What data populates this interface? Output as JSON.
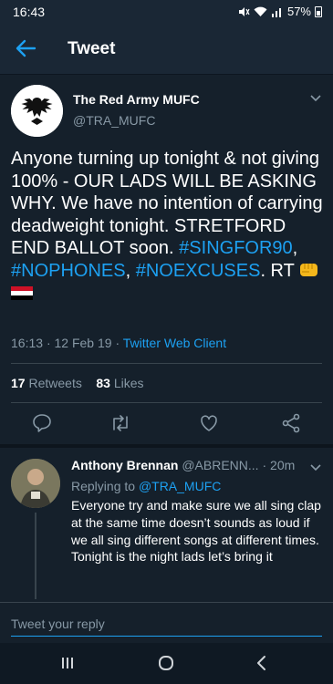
{
  "status": {
    "time": "16:43",
    "battery": "57%"
  },
  "header": {
    "title": "Tweet"
  },
  "tweet": {
    "author_name": "The Red Army MUFC",
    "author_handle": "@TRA_MUFC",
    "text_segments": [
      "Anyone turning up tonight & not giving 100% - OUR LADS WILL BE ASKING WHY. We have no intention of carrying deadweight tonight. STRETFORD END BALLOT soon. ",
      "#SINGFOR90",
      ", ",
      "#NOPHONES",
      ", ",
      "#NOEXCUSES",
      ". RT "
    ],
    "time": "16:13",
    "date": "12 Feb 19",
    "separator": "·",
    "client": "Twitter Web Client",
    "retweets_count": "17",
    "retweets_label": "Retweets",
    "likes_count": "83",
    "likes_label": "Likes"
  },
  "reply": {
    "name": "Anthony Brennan",
    "handle": "@ABRENN...",
    "age": "20m",
    "replying_prefix": "Replying to",
    "replying_handle": "@TRA_MUFC",
    "text": "Everyone try and make sure we all sing clap at the same time doesn’t sounds as loud if we all sing different songs at different times. Tonight is the night lads let’s bring it"
  },
  "compose": {
    "placeholder": "Tweet your reply"
  },
  "colors": {
    "background": "#15202b",
    "accent": "#1da1f2",
    "muted": "#8899a6",
    "divider": "#38444d"
  },
  "icons": [
    "back-arrow-icon",
    "chevron-down-icon",
    "reply-icon",
    "retweet-icon",
    "like-icon",
    "share-icon",
    "recents-icon",
    "home-icon",
    "back-nav-icon",
    "wifi-icon",
    "signal-icon",
    "battery-icon",
    "mute-icon"
  ]
}
